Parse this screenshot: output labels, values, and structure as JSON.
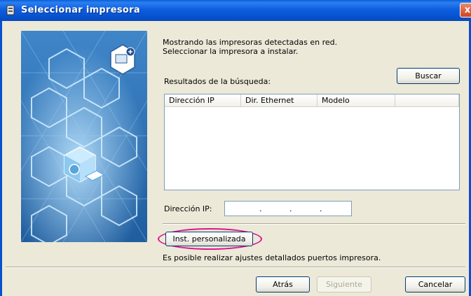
{
  "window": {
    "title": "Seleccionar impresora",
    "close_label": "x"
  },
  "intro": {
    "line1": "Mostrando las impresoras detectadas en red.",
    "line2": "Seleccionar la impresora a instalar."
  },
  "search": {
    "results_label": "Resultados de la búsqueda:",
    "button_label": "Buscar"
  },
  "table": {
    "columns": [
      "Dirección IP",
      "Dir. Ethernet",
      "Modelo"
    ],
    "rows": []
  },
  "ip": {
    "label": "Dirección IP:",
    "value": ""
  },
  "custom_install": {
    "button_label": "Inst. personalizada",
    "description": "Es posible realizar ajustes detallados puertos impresora."
  },
  "footer": {
    "back_label": "Atrás",
    "next_label": "Siguiente",
    "cancel_label": "Cancelar"
  },
  "colors": {
    "titlebar": "#0a5fd8",
    "highlight": "#e0138b",
    "panel_background": "#2e6fb3"
  },
  "icons": {
    "title": "printer-app-icon",
    "panel_badge": "add-printer-icon",
    "panel_cube": "network-printer-cube-icon"
  }
}
